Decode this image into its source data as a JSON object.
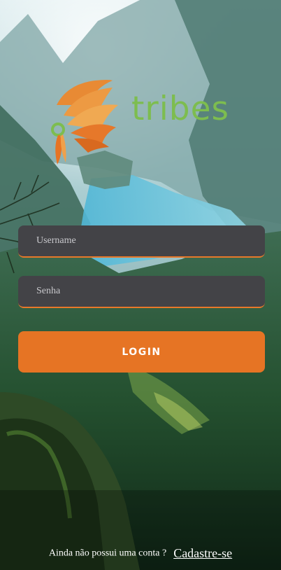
{
  "brand": {
    "name": "tribes",
    "logo_icon": "feather-headdress-icon",
    "word_color": "#7dbd4f",
    "accent": "#e67424"
  },
  "login_form": {
    "username_placeholder": "Username",
    "password_placeholder": "Senha",
    "login_label": "LOGIN"
  },
  "footer": {
    "prompt": "Ainda não possui uma conta ?",
    "signup_link": "Cadastre-se"
  }
}
